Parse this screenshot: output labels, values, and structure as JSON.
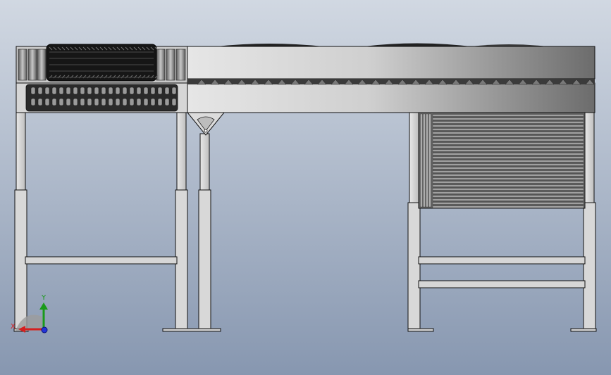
{
  "viewport": {
    "background_top": "#cfd6e0",
    "background_bottom": "#8b9bb3"
  },
  "colors": {
    "frame_fill": "#d7d7d7",
    "frame_stroke": "#1a1a1a",
    "tire_dark": "#1c1c1c",
    "roller_metal": "#9a9a9a",
    "belt_light": "#dcdcdc",
    "belt_dark": "#6f6f6f",
    "axis_x": "#d42020",
    "axis_y": "#20a020",
    "axis_z": "#2030d0"
  },
  "triad": {
    "x_label": "X",
    "y_label": "Y",
    "x_icon": "x-axis-arrow-icon",
    "y_icon": "y-axis-arrow-icon",
    "z_icon": "z-axis-dot-icon"
  }
}
